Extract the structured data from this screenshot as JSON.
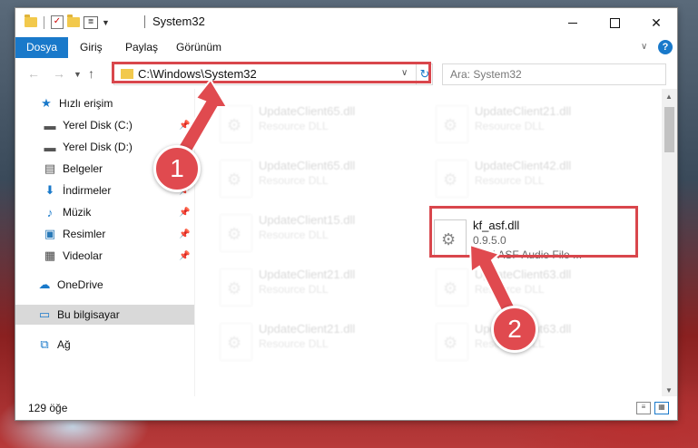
{
  "window": {
    "title": "System32"
  },
  "ribbon": {
    "tabs": [
      "Dosya",
      "Giriş",
      "Paylaş",
      "Görünüm"
    ],
    "help_label": "?"
  },
  "nav": {
    "address": "C:\\Windows\\System32",
    "search_placeholder": "Ara: System32"
  },
  "sidebar": {
    "items": [
      {
        "label": "Hızlı erişim",
        "icon": "star-icon"
      },
      {
        "label": "Yerel Disk (C:)",
        "icon": "drive-icon"
      },
      {
        "label": "Yerel Disk (D:)",
        "icon": "drive-icon"
      },
      {
        "label": "Belgeler",
        "icon": "documents-icon"
      },
      {
        "label": "İndirmeler",
        "icon": "download-icon"
      },
      {
        "label": "Müzik",
        "icon": "music-icon"
      },
      {
        "label": "Resimler",
        "icon": "pictures-icon"
      },
      {
        "label": "Videolar",
        "icon": "videos-icon"
      },
      {
        "label": "OneDrive",
        "icon": "cloud-icon"
      },
      {
        "label": "Bu bilgisayar",
        "icon": "computer-icon"
      },
      {
        "label": "Ağ",
        "icon": "network-icon"
      }
    ]
  },
  "files": {
    "col1": [
      {
        "name": "UpdateClient65.dll",
        "type": "Resource DLL"
      },
      {
        "name": "UpdateClient65.dll",
        "type": "Resource DLL"
      },
      {
        "name": "UpdateClient15.dll",
        "type": "Resource DLL"
      },
      {
        "name": "UpdateClient21.dll",
        "type": "Resource DLL"
      },
      {
        "name": "UpdateClient21.dll",
        "type": "Resource DLL"
      }
    ],
    "col2": [
      {
        "name": "UpdateClient21.dll",
        "type": "Resource DLL"
      },
      {
        "name": "UpdateClient42.dll",
        "type": "Resource DLL"
      },
      {
        "name": "kf_asf.dll",
        "type": "0.9.5.0",
        "desc": "ANX ASF Audio File ..."
      },
      {
        "name": "UpdateClient63.dll",
        "type": "Resource DLL"
      },
      {
        "name": "UpdateClient63.dll",
        "type": "Resource DLL"
      }
    ]
  },
  "status": {
    "count": "129 öğe"
  },
  "annotations": {
    "badge1": "1",
    "badge2": "2",
    "color": "#e04a4f"
  }
}
